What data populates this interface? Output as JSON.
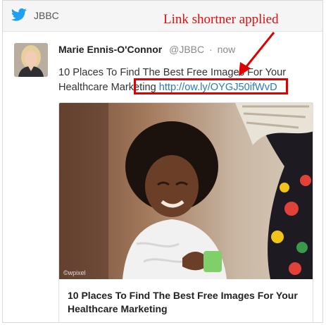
{
  "header": {
    "account_name": "JBBC",
    "icon": "twitter-bird-icon"
  },
  "annotation": {
    "text": "Link shortner applied",
    "color": "#e01010"
  },
  "tweet": {
    "author_name": "Marie Ennis-O'Connor",
    "handle": "@JBBC",
    "separator": "·",
    "timestamp": "now",
    "text": "10 Places To Find The Best Free Images For Your Healthcare Marketing ",
    "link": "http://ow.ly/OYGJ50ifWvD"
  },
  "card": {
    "title": "10 Places To Find The Best Free Images For Your Healthcare Marketing",
    "image_credit": "©wpixel"
  },
  "colors": {
    "link": "#2b7bb9",
    "highlight_box": "#e00000",
    "twitter_blue": "#1da1f2"
  }
}
